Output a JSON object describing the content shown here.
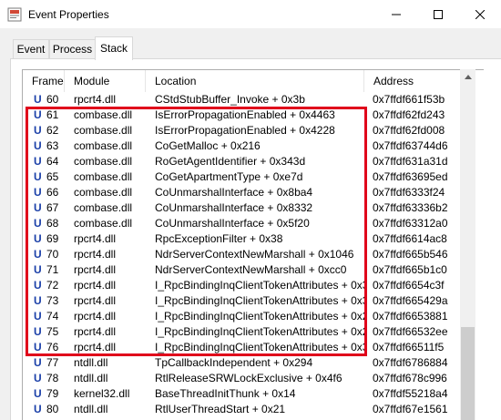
{
  "window": {
    "title": "Event Properties",
    "icon": "event-properties-icon",
    "minimize_icon": "minimize-icon",
    "maximize_icon": "maximize-icon",
    "close_icon": "close-icon"
  },
  "tabs": [
    {
      "label": "Event"
    },
    {
      "label": "Process"
    },
    {
      "label": "Stack",
      "selected": true
    }
  ],
  "stack": {
    "columns": [
      "Frame",
      "Module",
      "Location",
      "Address"
    ],
    "frame_marker": "U",
    "rows": [
      {
        "frame": "60",
        "module": "rpcrt4.dll",
        "location": "CStdStubBuffer_Invoke + 0x3b",
        "address": "0x7ffdf661f53b"
      },
      {
        "frame": "61",
        "module": "combase.dll",
        "location": "IsErrorPropagationEnabled + 0x4463",
        "address": "0x7ffdf62fd243"
      },
      {
        "frame": "62",
        "module": "combase.dll",
        "location": "IsErrorPropagationEnabled + 0x4228",
        "address": "0x7ffdf62fd008"
      },
      {
        "frame": "63",
        "module": "combase.dll",
        "location": "CoGetMalloc + 0x216",
        "address": "0x7ffdf63744d6"
      },
      {
        "frame": "64",
        "module": "combase.dll",
        "location": "RoGetAgentIdentifier + 0x343d",
        "address": "0x7ffdf631a31d"
      },
      {
        "frame": "65",
        "module": "combase.dll",
        "location": "CoGetApartmentType + 0xe7d",
        "address": "0x7ffdf63695ed"
      },
      {
        "frame": "66",
        "module": "combase.dll",
        "location": "CoUnmarshalInterface + 0x8ba4",
        "address": "0x7ffdf6333f24"
      },
      {
        "frame": "67",
        "module": "combase.dll",
        "location": "CoUnmarshalInterface + 0x8332",
        "address": "0x7ffdf63336b2"
      },
      {
        "frame": "68",
        "module": "combase.dll",
        "location": "CoUnmarshalInterface + 0x5f20",
        "address": "0x7ffdf63312a0"
      },
      {
        "frame": "69",
        "module": "rpcrt4.dll",
        "location": "RpcExceptionFilter + 0x38",
        "address": "0x7ffdf6614ac8"
      },
      {
        "frame": "70",
        "module": "rpcrt4.dll",
        "location": "NdrServerContextNewMarshall + 0x1046",
        "address": "0x7ffdf665b546"
      },
      {
        "frame": "71",
        "module": "rpcrt4.dll",
        "location": "NdrServerContextNewMarshall + 0xcc0",
        "address": "0x7ffdf665b1c0"
      },
      {
        "frame": "72",
        "module": "rpcrt4.dll",
        "location": "I_RpcBindingInqClientTokenAttributes + 0x3ddf",
        "address": "0x7ffdf6654c3f"
      },
      {
        "frame": "73",
        "module": "rpcrt4.dll",
        "location": "I_RpcBindingInqClientTokenAttributes + 0x343a",
        "address": "0x7ffdf665429a"
      },
      {
        "frame": "74",
        "module": "rpcrt4.dll",
        "location": "I_RpcBindingInqClientTokenAttributes + 0x2a21",
        "address": "0x7ffdf6653881"
      },
      {
        "frame": "75",
        "module": "rpcrt4.dll",
        "location": "I_RpcBindingInqClientTokenAttributes + 0x248e",
        "address": "0x7ffdf66532ee"
      },
      {
        "frame": "76",
        "module": "rpcrt4.dll",
        "location": "I_RpcBindingInqClientTokenAttributes + 0x395",
        "address": "0x7ffdf66511f5"
      },
      {
        "frame": "77",
        "module": "ntdll.dll",
        "location": "TpCallbackIndependent + 0x294",
        "address": "0x7ffdf6786884"
      },
      {
        "frame": "78",
        "module": "ntdll.dll",
        "location": "RtlReleaseSRWLockExclusive + 0x4f6",
        "address": "0x7ffdf678c996"
      },
      {
        "frame": "79",
        "module": "kernel32.dll",
        "location": "BaseThreadInitThunk + 0x14",
        "address": "0x7ffdf55218a4"
      },
      {
        "frame": "80",
        "module": "ntdll.dll",
        "location": "RtlUserThreadStart + 0x21",
        "address": "0x7ffdf67e1561"
      }
    ]
  },
  "annotation": {
    "color": "#e0001b",
    "frames_highlighted": [
      "61",
      "76"
    ]
  }
}
